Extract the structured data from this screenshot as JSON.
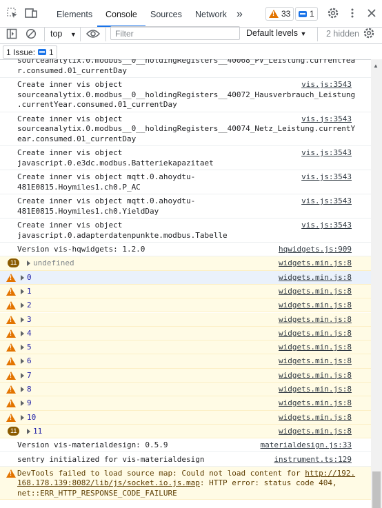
{
  "tabs": {
    "items": [
      "Elements",
      "Console",
      "Sources",
      "Network"
    ],
    "overflow": "»",
    "warnings": "33",
    "messages": "1"
  },
  "toolbar": {
    "context": "top",
    "filter_placeholder": "Filter",
    "levels": "Default levels",
    "hidden": "2 hidden"
  },
  "issues": {
    "label": "1 Issue:",
    "count": "1"
  },
  "colors": {
    "accent": "#1a73e8",
    "warn_bg": "#fffbe5",
    "warn_icon": "#e37400",
    "count_badge": "#8a5a00"
  },
  "console": {
    "rows": [
      {
        "type": "log",
        "text": "sourceanalytix.0.modbus__0__holdingRegisters__40068_PV_Leistung.currentYea\nr.consumed.01_currentDay",
        "src": ""
      },
      {
        "type": "log",
        "text": "Create inner vis object\nsourceanalytix.0.modbus__0__holdingRegisters__40072_Hausverbrauch_Leistung\n.currentYear.consumed.01_currentDay",
        "src": "vis.js:3543"
      },
      {
        "type": "log",
        "text": "Create inner vis object\nsourceanalytix.0.modbus__0__holdingRegisters__40074_Netz_Leistung.currentY\near.consumed.01_currentDay",
        "src": "vis.js:3543"
      },
      {
        "type": "log",
        "text": "Create inner vis object\njavascript.0.e3dc.modbus.Batteriekapazitaet",
        "src": "vis.js:3543"
      },
      {
        "type": "log",
        "text": "Create inner vis object mqtt.0.ahoydtu-\n481E0815.Hoymiles1.ch0.P_AC",
        "src": "vis.js:3543"
      },
      {
        "type": "log",
        "text": "Create inner vis object mqtt.0.ahoydtu-\n481E0815.Hoymiles1.ch0.YieldDay",
        "src": "vis.js:3543"
      },
      {
        "type": "log",
        "text": "Create inner vis object\njavascript.0.adapterdatenpunkte.modbus.Tabelle",
        "src": "vis.js:3543"
      },
      {
        "type": "log",
        "text": "Version vis-hqwidgets: 1.2.0",
        "src": "hqwidgets.js:909"
      },
      {
        "type": "count",
        "count": "11",
        "text": "undefined",
        "src": "widgets.min.js:8"
      },
      {
        "type": "warn",
        "text": "0",
        "src": "widgets.min.js:8"
      },
      {
        "type": "warn",
        "text": "1",
        "src": "widgets.min.js:8"
      },
      {
        "type": "warn",
        "text": "2",
        "src": "widgets.min.js:8"
      },
      {
        "type": "warn",
        "text": "3",
        "src": "widgets.min.js:8"
      },
      {
        "type": "warn",
        "text": "4",
        "src": "widgets.min.js:8"
      },
      {
        "type": "warn",
        "text": "5",
        "src": "widgets.min.js:8"
      },
      {
        "type": "warn",
        "text": "6",
        "src": "widgets.min.js:8"
      },
      {
        "type": "warn",
        "text": "7",
        "src": "widgets.min.js:8"
      },
      {
        "type": "warn",
        "text": "8",
        "src": "widgets.min.js:8"
      },
      {
        "type": "warn",
        "text": "9",
        "src": "widgets.min.js:8"
      },
      {
        "type": "warn",
        "text": "10",
        "src": "widgets.min.js:8"
      },
      {
        "type": "count",
        "count": "11",
        "text": "11",
        "src": "widgets.min.js:8"
      },
      {
        "type": "log",
        "text": "Version vis-materialdesign: 0.5.9",
        "src": "materialdesign.js:33"
      },
      {
        "type": "log",
        "text": "sentry initialized for vis-materialdesign",
        "src": "instrument.ts:129"
      },
      {
        "type": "devtools",
        "text": "DevTools failed to load source map: Could not load content for ",
        "link": "http://192.\n168.178.139:8082/lib/js/socket.io.js.map",
        "rest": ": HTTP error: status code 404,\nnet::ERR_HTTP_RESPONSE_CODE_FAILURE",
        "src": ""
      }
    ]
  }
}
